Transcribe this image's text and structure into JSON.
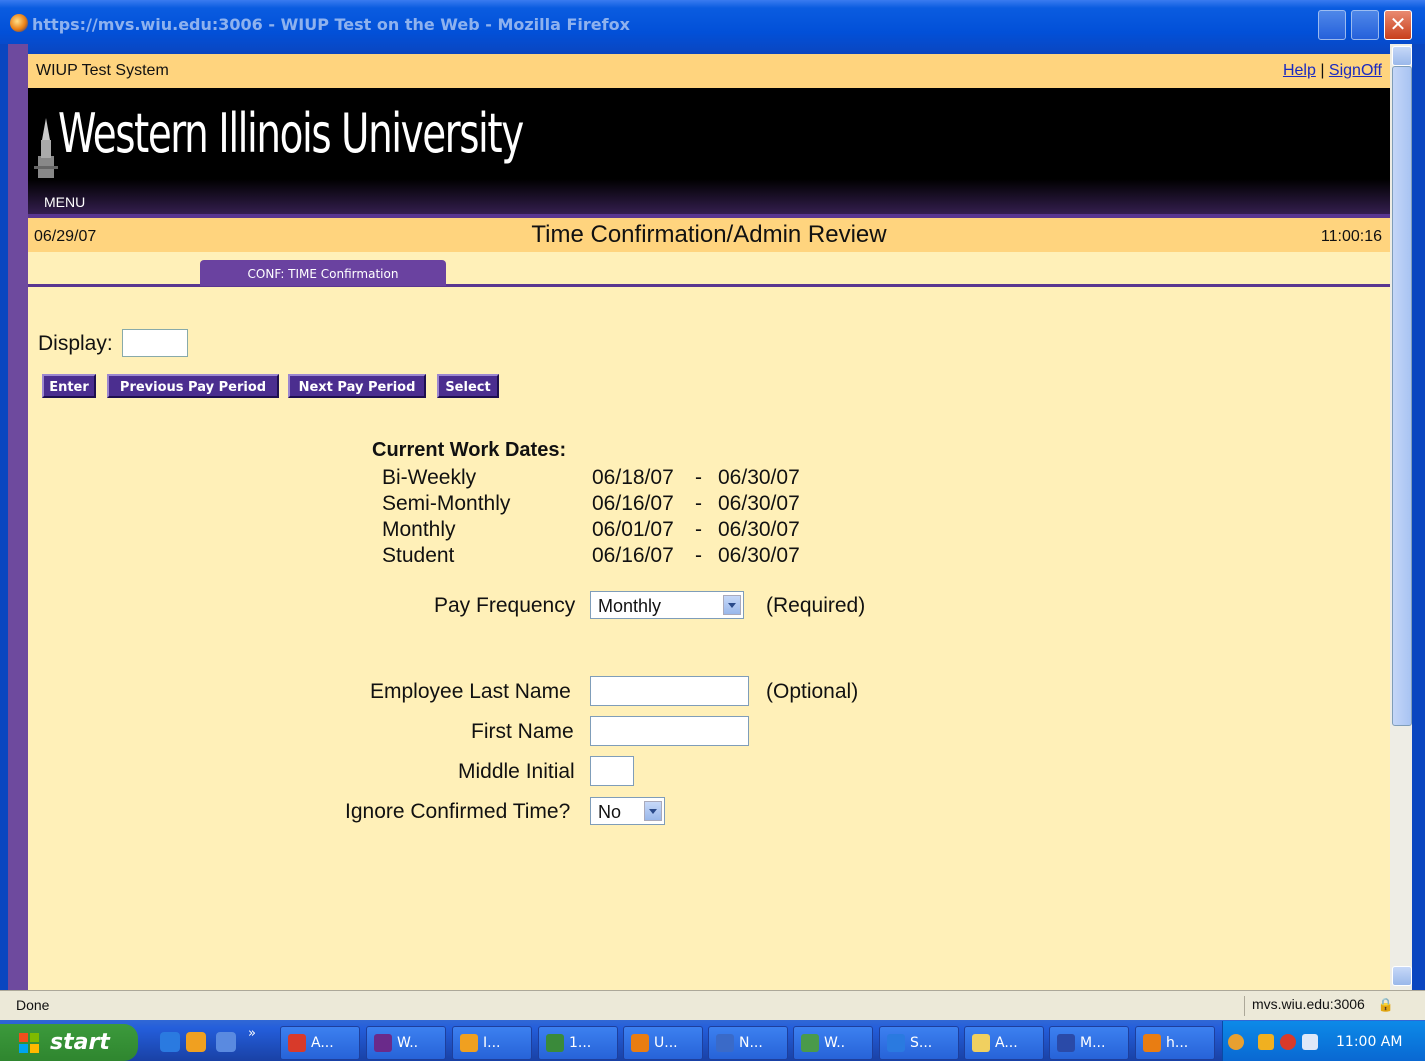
{
  "window": {
    "title": "https://mvs.wiu.edu:3006 - WIUP Test on the Web - Mozilla Firefox"
  },
  "page": {
    "system_name": "WIUP Test System",
    "help_label": "Help",
    "separator": "|",
    "signoff_label": "SignOff",
    "logo_text": "Western Illinois University",
    "menu_label": "MENU",
    "date": "06/29/07",
    "title": "Time Confirmation/Admin Review",
    "time": "11:00:16",
    "tab_label": "CONF: TIME Confirmation"
  },
  "form": {
    "display_label": "Display:",
    "display_value": "",
    "buttons": {
      "enter": "Enter",
      "previous": "Previous Pay Period",
      "next": "Next Pay Period",
      "select": "Select"
    },
    "current_work_dates_title": "Current Work Dates:",
    "work_dates": [
      {
        "name": "Bi-Weekly",
        "start": "06/18/07",
        "end": "06/30/07"
      },
      {
        "name": "Semi-Monthly",
        "start": "06/16/07",
        "end": "06/30/07"
      },
      {
        "name": "Monthly",
        "start": "06/01/07",
        "end": "06/30/07"
      },
      {
        "name": "Student",
        "start": "06/16/07",
        "end": "06/30/07"
      }
    ],
    "dash": "-",
    "pay_frequency_label": "Pay Frequency",
    "pay_frequency_value": "Monthly",
    "required_note": "(Required)",
    "last_name_label": "Employee Last Name",
    "last_name_value": "",
    "optional_note": "(Optional)",
    "first_name_label": "First Name",
    "first_name_value": "",
    "middle_initial_label": "Middle Initial",
    "middle_initial_value": "",
    "ignore_confirmed_label": "Ignore Confirmed Time?",
    "ignore_confirmed_value": "No"
  },
  "statusbar": {
    "status": "Done",
    "host": "mvs.wiu.edu:3006"
  },
  "taskbar": {
    "start_label": "start",
    "overflow": "»",
    "tasks": [
      {
        "label": "A...",
        "icon": "aim-icon",
        "color": "#d83a2a"
      },
      {
        "label": "W..",
        "icon": "terminal-icon",
        "color": "#6a2a8a"
      },
      {
        "label": "I...",
        "icon": "clock-app-icon",
        "color": "#f0a020"
      },
      {
        "label": "1...",
        "icon": "number-icon",
        "color": "#3a8a3a"
      },
      {
        "label": "U...",
        "icon": "firefox-icon",
        "color": "#e97d12"
      },
      {
        "label": "N...",
        "icon": "netscape-icon",
        "color": "#3a6ac8"
      },
      {
        "label": "W..",
        "icon": "network-icon",
        "color": "#4a9a4a"
      },
      {
        "label": "S...",
        "icon": "ie-icon",
        "color": "#2a7ae0"
      },
      {
        "label": "A...",
        "icon": "mail-icon",
        "color": "#f0d060"
      },
      {
        "label": "M...",
        "icon": "word-icon",
        "color": "#2a4aa8"
      },
      {
        "label": "h...",
        "icon": "firefox-icon",
        "color": "#e97d12"
      }
    ],
    "clock": "11:00 AM"
  }
}
